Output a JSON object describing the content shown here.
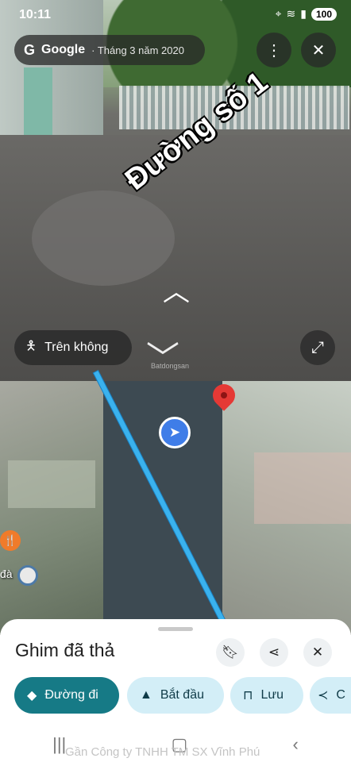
{
  "status_bar": {
    "time": "10:11",
    "icons": [
      "screen-record-icon",
      "location-icon",
      "wifi-icon",
      "signal-icon"
    ],
    "battery": "100"
  },
  "streetview": {
    "brand_logo": "G",
    "brand": "Google",
    "date": "· Tháng 3 năm 2020",
    "road_label": "Đường số 1",
    "aerial_button_label": "Trên không",
    "watermark": "Batdongsan"
  },
  "map": {
    "poi_label": "đà",
    "colors": {
      "route": "#3ab2ee",
      "pin": "#e53935",
      "location": "#3f7de8"
    }
  },
  "sheet": {
    "title": "Ghim đã thả",
    "chips": [
      {
        "label": "Đường đi",
        "icon": "directions-icon"
      },
      {
        "label": "Bắt đầu",
        "icon": "navigate-icon"
      },
      {
        "label": "Lưu",
        "icon": "bookmark-icon"
      },
      {
        "label": "C",
        "icon": "share-icon"
      }
    ]
  },
  "footer_watermark": "Gần Công ty TNHH TM SX Vĩnh Phú"
}
